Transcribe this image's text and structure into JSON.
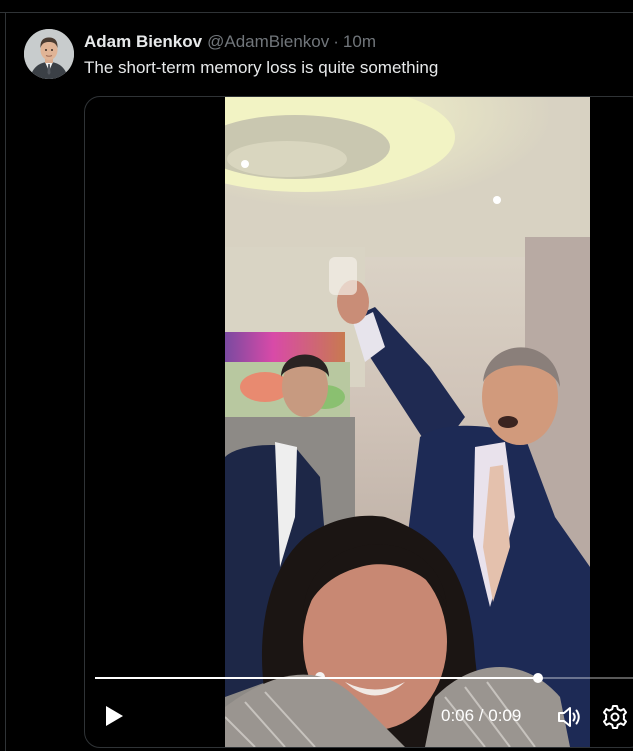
{
  "tweet": {
    "author_name": "Adam Bienkov",
    "author_handle": "@AdamBienkov",
    "separator": "·",
    "time_ago": "10m",
    "text": "The short-term memory loss is quite something"
  },
  "video": {
    "current_time": "0:06",
    "duration": "0:09",
    "time_display": "0:06 / 0:09",
    "progress_fraction": 0.82,
    "is_playing": false
  },
  "icons": {
    "play": "play-icon",
    "volume": "volume-icon",
    "settings": "settings-gear-icon"
  },
  "colors": {
    "background": "#000000",
    "primary_text": "#e7e9ea",
    "secondary_text": "#71767b",
    "border": "#2f3336",
    "controls": "#ffffff"
  }
}
